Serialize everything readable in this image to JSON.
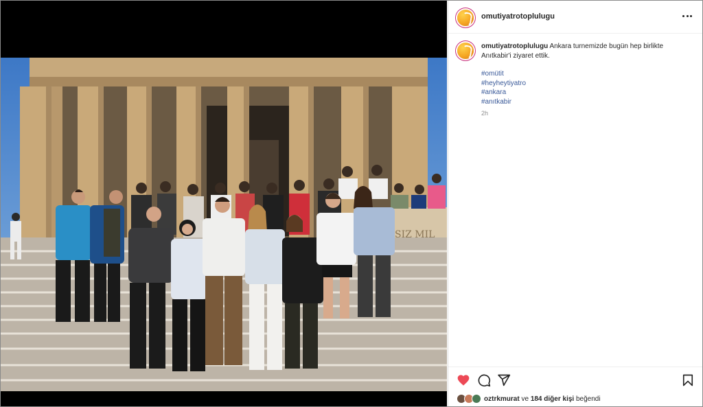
{
  "post": {
    "username": "omutiyatrotoplulugu",
    "caption_text": "Ankara turnemizde bugün hep birlikte Anıtkabir'i ziyaret ettik.",
    "hashtags": [
      "#omütit",
      "#heyheytiyatro",
      "#ankara",
      "#anıtkabir"
    ],
    "time_ago": "2h"
  },
  "likes": {
    "first_user": "oztrkmurat",
    "connector": "ve",
    "others": "184 diğer kişi",
    "suffix": "beğendi"
  },
  "icons": {
    "more": "more-options-icon",
    "like": "heart-filled-icon",
    "comment": "comment-icon",
    "share": "share-icon",
    "save": "bookmark-icon"
  },
  "colors": {
    "like_red": "#ed4956",
    "hashtag_blue": "#385898",
    "avatar_gold": "#f5a623"
  }
}
